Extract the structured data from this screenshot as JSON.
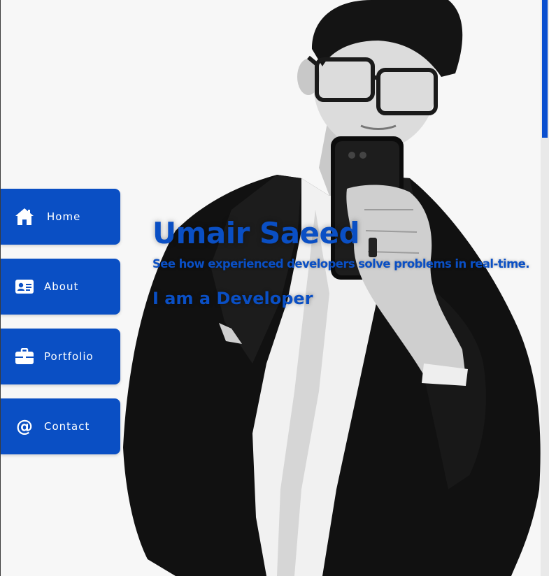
{
  "nav": {
    "items": [
      {
        "label": "Home",
        "icon": "home-icon"
      },
      {
        "label": "About",
        "icon": "id-card-icon"
      },
      {
        "label": "Portfolio",
        "icon": "briefcase-icon"
      },
      {
        "label": "Contact",
        "icon": "at-icon"
      }
    ]
  },
  "hero": {
    "name": "Umair Saeed",
    "tagline": "See how experienced developers solve problems in real-time.",
    "role": "I am a Developer"
  },
  "colors": {
    "accent": "#0a4fc4",
    "background": "#f7f7f7",
    "scrollbar_thumb": "#0a4fcf"
  }
}
